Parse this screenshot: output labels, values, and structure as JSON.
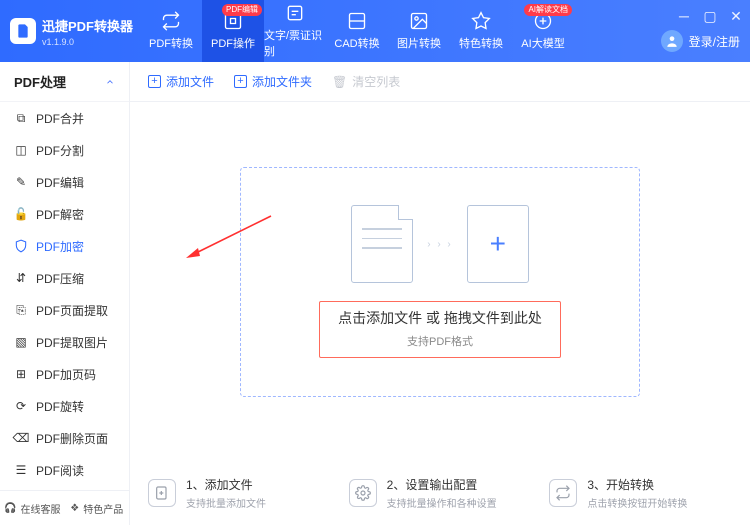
{
  "app": {
    "name": "迅捷PDF转换器",
    "version": "v1.1.9.0"
  },
  "top_tabs": [
    {
      "label": "PDF转换"
    },
    {
      "label": "PDF操作",
      "badge": "PDF编辑",
      "active": true
    },
    {
      "label": "文字/票证识别"
    },
    {
      "label": "CAD转换"
    },
    {
      "label": "图片转换"
    },
    {
      "label": "特色转换"
    },
    {
      "label": "AI大模型",
      "badge": "AI解读文档"
    }
  ],
  "auth": {
    "label": "登录/注册"
  },
  "sidebar": {
    "header": "PDF处理",
    "items": [
      {
        "label": "PDF合并"
      },
      {
        "label": "PDF分割"
      },
      {
        "label": "PDF编辑"
      },
      {
        "label": "PDF解密"
      },
      {
        "label": "PDF加密",
        "active": true
      },
      {
        "label": "PDF压缩"
      },
      {
        "label": "PDF页面提取"
      },
      {
        "label": "PDF提取图片"
      },
      {
        "label": "PDF加页码"
      },
      {
        "label": "PDF旋转"
      },
      {
        "label": "PDF删除页面"
      },
      {
        "label": "PDF阅读"
      }
    ],
    "footer": {
      "support": "在线客服",
      "featured": "特色产品"
    }
  },
  "toolbar": {
    "add_file": "添加文件",
    "add_folder": "添加文件夹",
    "clear_list": "清空列表"
  },
  "drop": {
    "line1": "点击添加文件 或 拖拽文件到此处",
    "line2": "支持PDF格式"
  },
  "steps": [
    {
      "title": "1、添加文件",
      "sub": "支持批量添加文件"
    },
    {
      "title": "2、设置输出配置",
      "sub": "支持批量操作和各种设置"
    },
    {
      "title": "3、开始转换",
      "sub": "点击转换按钮开始转换"
    }
  ]
}
